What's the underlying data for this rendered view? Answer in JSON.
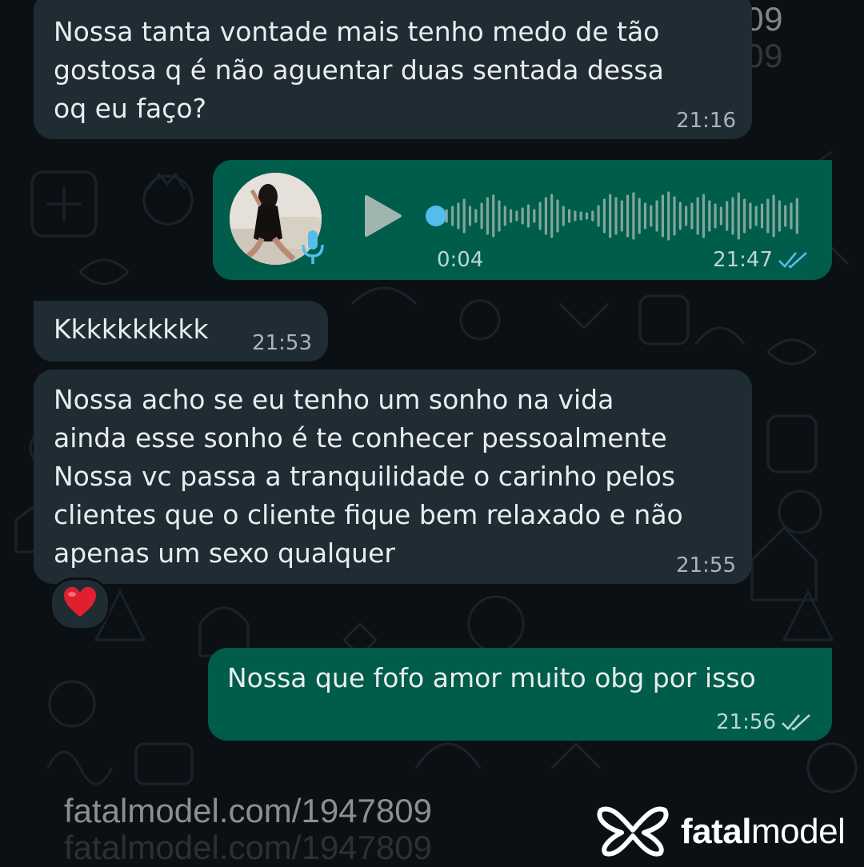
{
  "watermark": {
    "site": "fatalmodel.com/1947809"
  },
  "brand": {
    "bold": "fatal",
    "rest": "model"
  },
  "messages": {
    "m1": {
      "text": "Nossa tanta vontade mais tenho medo de tão\ngostosa q é não aguentar duas sentada dessa\noq eu faço?",
      "time": "21:16",
      "direction": "incoming"
    },
    "m2": {
      "type": "voice",
      "duration": "0:04",
      "time": "21:47",
      "direction": "outgoing",
      "status": "read",
      "progress": 0
    },
    "m3": {
      "text": "Kkkkkkkkkk",
      "time": "21:53",
      "direction": "incoming"
    },
    "m4": {
      "text": "Nossa acho se eu tenho um sonho na vida\nainda esse sonho é te conhecer pessoalmente\nNossa vc passa a tranquilidade o carinho pelos\nclientes que o cliente fique bem relaxado e não\napenas um sexo qualquer",
      "time": "21:55",
      "direction": "incoming",
      "reaction": "❤️"
    },
    "m5": {
      "text": "Nossa que fofo amor muito obg por isso",
      "time": "21:56",
      "direction": "outgoing",
      "status": "delivered"
    }
  },
  "icons": [
    "play-icon",
    "microphone-icon",
    "double-check-icon",
    "heart-icon",
    "fatalmodel-logo-icon"
  ],
  "colors": {
    "incoming": "#1f2c33",
    "outgoing": "#005c4b",
    "background": "#0b1014",
    "read_tick": "#53bdeb",
    "accent_dot": "#53bdeb"
  }
}
